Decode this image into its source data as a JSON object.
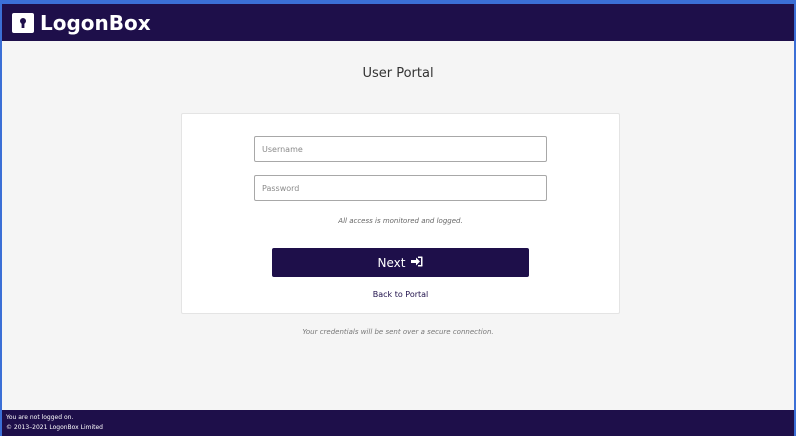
{
  "header": {
    "brand": "LogonBox",
    "logo_icon": "keyhole-icon"
  },
  "main": {
    "title": "User Portal",
    "username": {
      "placeholder": "Username",
      "value": ""
    },
    "password": {
      "placeholder": "Password",
      "value": ""
    },
    "notice": "All access is monitored and logged.",
    "next_label": "Next",
    "next_icon": "sign-in-icon",
    "back_link": "Back to Portal",
    "secure_note": "Your credentials will be sent over a secure connection."
  },
  "footer": {
    "status": "You are not logged on.",
    "copyright": "© 2013–2021 LogonBox Limited"
  },
  "colors": {
    "brand": "#1e0f4a",
    "background": "#f5f5f5",
    "frame": "#3b6fd6"
  }
}
